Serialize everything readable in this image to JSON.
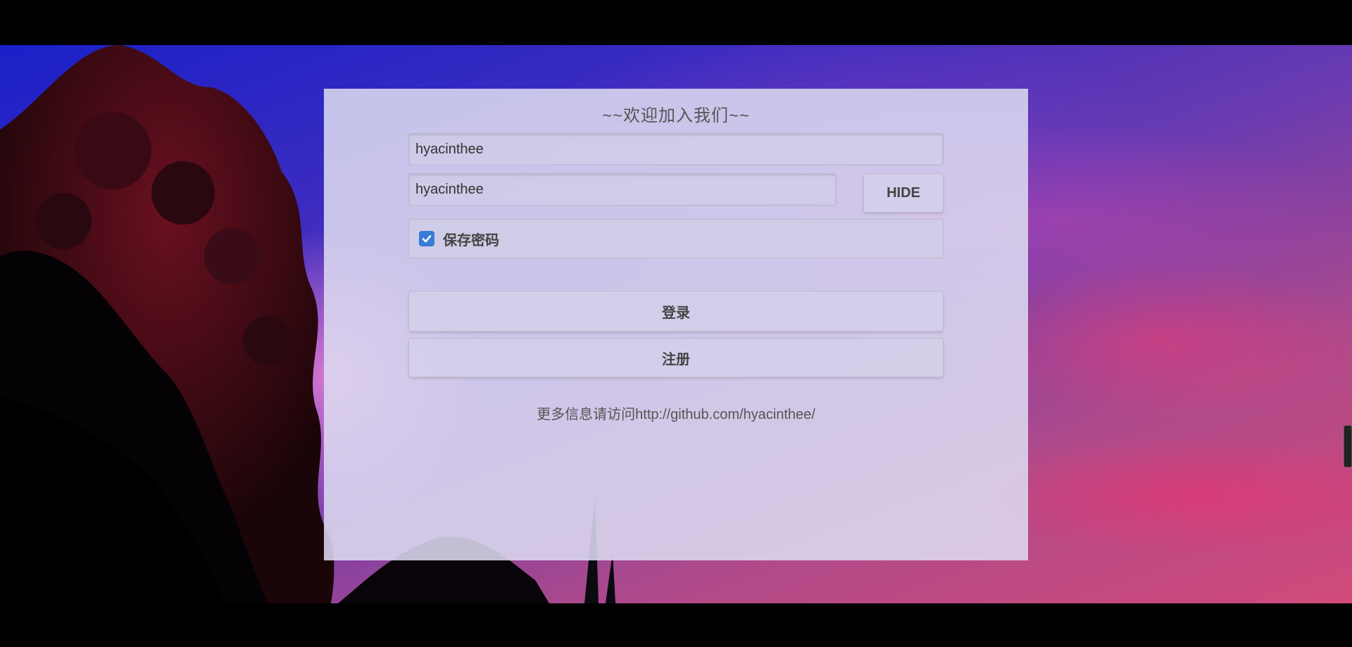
{
  "panel": {
    "title": "~~欢迎加入我们~~",
    "username_value": "hyacinthee",
    "password_value": "hyacinthee",
    "hide_button_label": "HIDE",
    "remember_label": "保存密码",
    "remember_checked": true,
    "login_label": "登录",
    "register_label": "注册",
    "info_text": "更多信息请访问http://github.com/hyacinthee/"
  },
  "colors": {
    "checkbox_accent": "#3a7bd5",
    "panel_background": "#dcdaf0"
  },
  "icons": {
    "checkbox": "check-icon"
  }
}
